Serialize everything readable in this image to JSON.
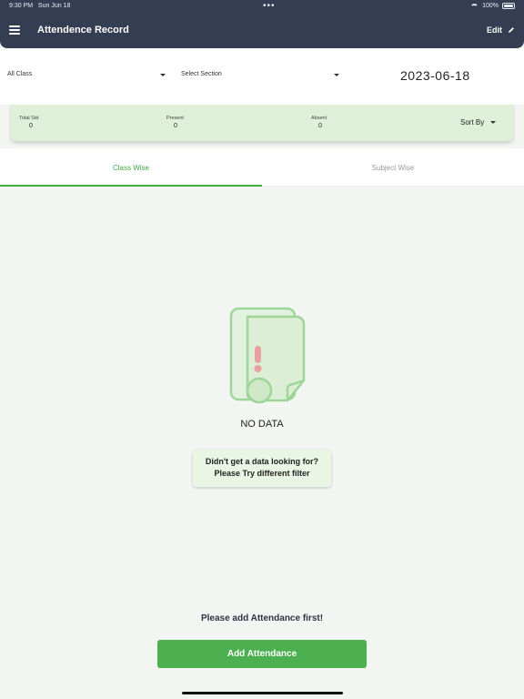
{
  "status_bar": {
    "time": "9:30 PM",
    "date": "Sun Jun 18",
    "battery": "100%"
  },
  "header": {
    "title": "Attendence Record",
    "edit_label": "Edit"
  },
  "filters": {
    "class_label": "All Class",
    "section_label": "Select Section",
    "date": "2023-06-18"
  },
  "stats": {
    "total_label": "Total Std",
    "total_value": "0",
    "present_label": "Present",
    "present_value": "0",
    "absent_label": "Absent",
    "absent_value": "0",
    "sort_label": "Sort By"
  },
  "tabs": [
    {
      "label": "Class Wise",
      "active": true
    },
    {
      "label": "Subject Wise",
      "active": false
    }
  ],
  "empty_state": {
    "title": "NO DATA",
    "hint_line1": "Didn't get a data looking for?",
    "hint_line2": "Please Try different filter"
  },
  "footer": {
    "message": "Please add Attendance first!",
    "button_label": "Add Attendance"
  },
  "colors": {
    "header": "#343d52",
    "accent_green": "#4caf50",
    "stats_bg": "#dff0d8"
  }
}
